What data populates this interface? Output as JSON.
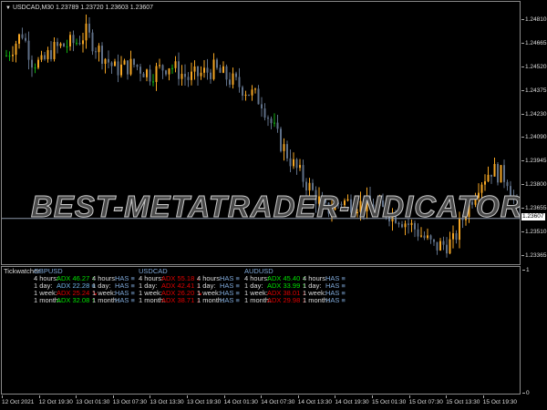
{
  "chart": {
    "symbol_line": "USDCAD,M30  1.23789 1.23720 1.23603 1.23607",
    "current_price": "1.23607",
    "watermark": "BEST-METATRADER-INDICATORS.COM",
    "colors": {
      "bull": "#f5a623",
      "bear": "#5f7088",
      "doji": "#10b010",
      "price_line": "#8a96a8"
    },
    "price_axis": [
      "1.24810",
      "1.24665",
      "1.24520",
      "1.24375",
      "1.24230",
      "1.24090",
      "1.23945",
      "1.23800",
      "1.23655",
      "1.23510",
      "1.23365"
    ],
    "price_axis_values": [
      1.2481,
      1.24665,
      1.2452,
      1.24375,
      1.2423,
      1.2409,
      1.23945,
      1.238,
      1.23655,
      1.2351,
      1.23365
    ],
    "price_path": [
      [
        0,
        1.24604
      ],
      [
        3,
        1.24687
      ],
      [
        5,
        1.24743
      ],
      [
        8,
        1.24576
      ],
      [
        11,
        1.24548
      ],
      [
        14,
        1.24632
      ],
      [
        17,
        1.24659
      ],
      [
        22,
        1.24687
      ],
      [
        25,
        1.24743
      ],
      [
        28,
        1.24659
      ],
      [
        34,
        1.2452
      ],
      [
        40,
        1.24548
      ],
      [
        45,
        1.24492
      ],
      [
        51,
        1.24548
      ],
      [
        57,
        1.24464
      ],
      [
        65,
        1.2452
      ],
      [
        74,
        1.24408
      ],
      [
        80,
        1.24325
      ],
      [
        85,
        1.24102
      ],
      [
        90,
        1.23934
      ],
      [
        94,
        1.23823
      ],
      [
        100,
        1.23656
      ],
      [
        105,
        1.23711
      ],
      [
        114,
        1.23683
      ],
      [
        122,
        1.23628
      ],
      [
        128,
        1.23544
      ],
      [
        134,
        1.23432
      ],
      [
        140,
        1.2346
      ],
      [
        144,
        1.23656
      ],
      [
        148,
        1.23823
      ],
      [
        152,
        1.23907
      ],
      [
        157,
        1.23851
      ],
      [
        161,
        1.23607
      ]
    ]
  },
  "indicator_axis": {
    "top": "1",
    "bottom": "0"
  },
  "time_axis": [
    "12 Oct 2021",
    "12 Oct 19:30",
    "13 Oct 01:30",
    "13 Oct 07:30",
    "13 Oct 13:30",
    "13 Oct 19:30",
    "14 Oct 01:30",
    "14 Oct 07:30",
    "14 Oct 13:30",
    "14 Oct 19:30",
    "15 Oct 01:30",
    "15 Oct 07:30",
    "15 Oct 13:30",
    "15 Oct 19:30"
  ],
  "tickwatcher": {
    "title": "Tickwatcher",
    "pairs": [
      {
        "name": "GBPUSD",
        "rows": [
          {
            "tf": "4 hours:",
            "adx": "ADX 46.27",
            "dir": "g",
            "arrow": "↑",
            "has": "HAS",
            "has_icon": "≡"
          },
          {
            "tf": "1 day:",
            "adx": "ADX 22.28",
            "dir": "n",
            "arrow": "≡",
            "has": "HAS",
            "has_icon": "≡"
          },
          {
            "tf": "1 week:",
            "adx": "ADX 25.24",
            "dir": "r",
            "arrow": "↘",
            "has": "HAS",
            "has_icon": "≡"
          },
          {
            "tf": "1 month:",
            "adx": "ADX 32.08",
            "dir": "g",
            "arrow": "↑",
            "has": "HAS",
            "has_icon": "≡"
          }
        ]
      },
      {
        "name": "USDCAD",
        "rows": [
          {
            "tf": "4 hours:",
            "adx": "ADX 55.18",
            "dir": "r",
            "arrow": "↓",
            "has": "HAS",
            "has_icon": "≡"
          },
          {
            "tf": "1 day:",
            "adx": "ADX 42.41",
            "dir": "r",
            "arrow": "↓",
            "has": "HAS",
            "has_icon": "≡"
          },
          {
            "tf": "1 week:",
            "adx": "ADX 26.20",
            "dir": "r",
            "arrow": "↘",
            "has": "HAS",
            "has_icon": "≡"
          },
          {
            "tf": "1 month:",
            "adx": "ADX 38.71",
            "dir": "r",
            "arrow": "↓",
            "has": "HAS",
            "has_icon": "≡"
          }
        ]
      },
      {
        "name": "AUDUSD",
        "rows": [
          {
            "tf": "4 hours:",
            "adx": "ADX 45.40",
            "dir": "g",
            "arrow": "↑",
            "has": "HAS",
            "has_icon": "≡"
          },
          {
            "tf": "1 day:",
            "adx": "ADX 33.99",
            "dir": "g",
            "arrow": "↑",
            "has": "HAS",
            "has_icon": "≡"
          },
          {
            "tf": "1 week:",
            "adx": "ADX 38.01",
            "dir": "r",
            "arrow": "↓",
            "has": "HAS",
            "has_icon": "≡"
          },
          {
            "tf": "1 month:",
            "adx": "ADX 29.98",
            "dir": "r",
            "arrow": "↓",
            "has": "HAS",
            "has_icon": "≡"
          }
        ]
      }
    ]
  }
}
